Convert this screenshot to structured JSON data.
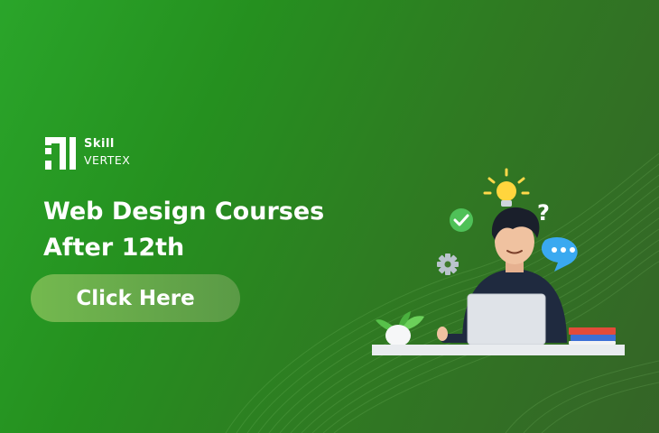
{
  "brand": {
    "line1": "Skill",
    "line2": "VERTEX",
    "logo_icon": "skillvertex-logo-icon"
  },
  "headline": {
    "line1": "Web Design Courses",
    "line2": "After 12th"
  },
  "cta": {
    "label": "Click Here"
  },
  "illustration": {
    "icons": [
      "lightbulb-icon",
      "check-icon",
      "question-icon",
      "chat-bubble-icon",
      "gear-icon"
    ]
  },
  "colors": {
    "background_left": "#2aa52a",
    "background_right": "#356427",
    "button": "#6aae4c",
    "text": "#ffffff"
  }
}
